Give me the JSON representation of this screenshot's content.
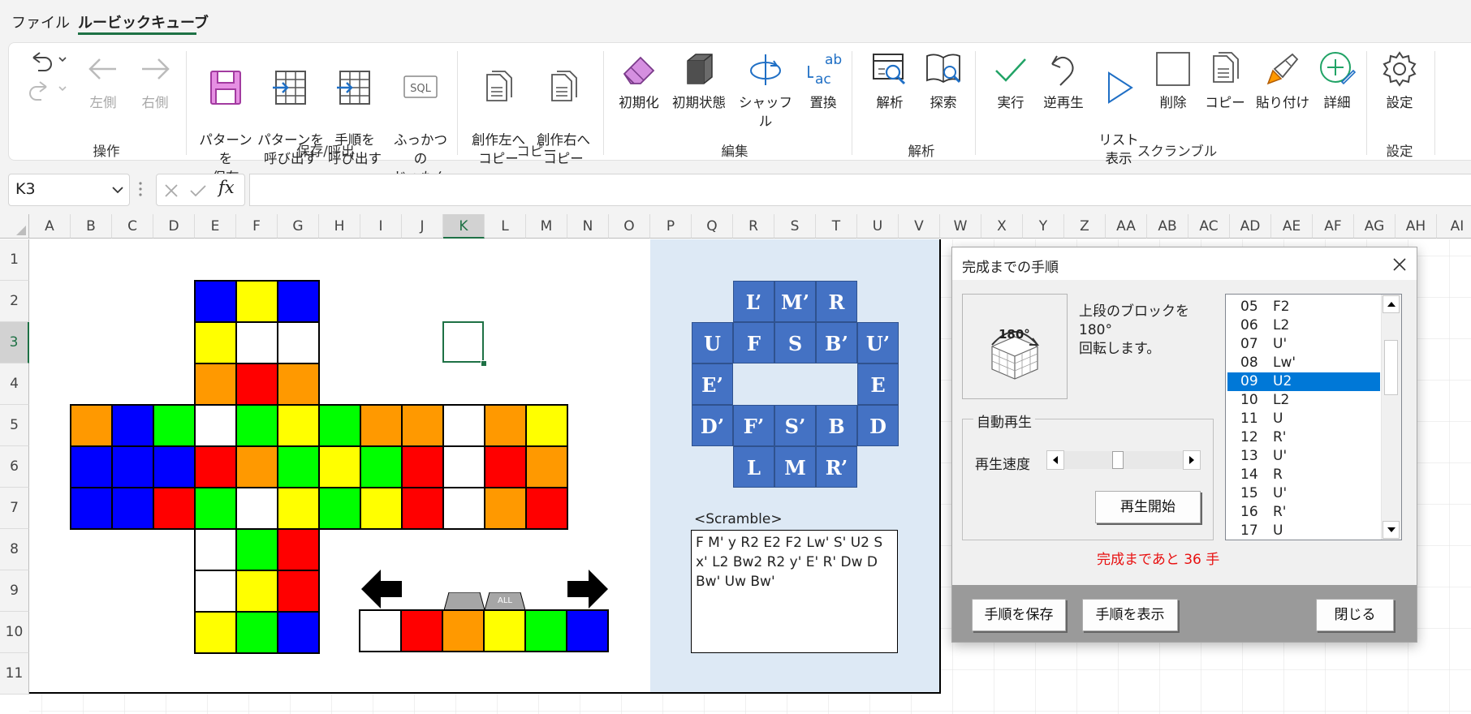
{
  "tabs": [
    "ファイル",
    "ルービックキューブ"
  ],
  "ribbon": {
    "groups": [
      {
        "label": "操作",
        "buttons": [
          "左側",
          "右側"
        ]
      },
      {
        "label": "保存/呼出",
        "buttons": [
          "パターンを\n保存",
          "パターンを\n呼び出す",
          "手順を\n呼び出す",
          "ふっかつの\nじゅもん"
        ]
      },
      {
        "label": "コピー",
        "buttons": [
          "創作左へ\nコピー",
          "創作右へ\nコピー"
        ]
      },
      {
        "label": "編集",
        "buttons": [
          "初期化",
          "初期状態",
          "シャッフル",
          "置換"
        ]
      },
      {
        "label": "解析",
        "buttons": [
          "解析",
          "探索"
        ]
      },
      {
        "label": "スクランブル",
        "buttons": [
          "実行",
          "逆再生",
          "リスト\n表示",
          "削除",
          "コピー",
          "貼り付け",
          "詳細"
        ]
      },
      {
        "label": "設定",
        "buttons": [
          "設定"
        ]
      }
    ]
  },
  "formula_bar": {
    "name_box": "K3",
    "fx": "fx",
    "formula": ""
  },
  "columns": [
    "A",
    "B",
    "C",
    "D",
    "E",
    "F",
    "G",
    "H",
    "I",
    "J",
    "K",
    "L",
    "M",
    "N",
    "O",
    "P",
    "Q",
    "R",
    "S",
    "T",
    "U",
    "V",
    "W",
    "X",
    "Y",
    "Z",
    "AA",
    "AB",
    "AC",
    "AD",
    "AE",
    "AF",
    "AG",
    "AH",
    "AI"
  ],
  "rows": [
    "1",
    "2",
    "3",
    "4",
    "5",
    "6",
    "7",
    "8",
    "9",
    "10",
    "11"
  ],
  "colors": {
    "B": "#0000ff",
    "Y": "#ffff00",
    "W": "#ffffff",
    "O": "#ff9900",
    "R": "#ff0000",
    "G": "#00ff00",
    "accent": "#1e7145",
    "move_blue": "#4472c4",
    "panel_bg": "#dde9f5"
  },
  "cube_net": {
    "up": [
      [
        "B",
        "Y",
        "B"
      ],
      [
        "Y",
        "W",
        "W"
      ],
      [
        "O",
        "R",
        "O"
      ]
    ],
    "middle": [
      [
        "O",
        "B",
        "G",
        "W",
        "G",
        "Y",
        "G",
        "O",
        "O",
        "W",
        "O",
        "Y"
      ],
      [
        "B",
        "B",
        "B",
        "R",
        "O",
        "G",
        "Y",
        "G",
        "R",
        "W",
        "R",
        "O"
      ],
      [
        "B",
        "B",
        "R",
        "G",
        "W",
        "Y",
        "G",
        "Y",
        "R",
        "W",
        "O",
        "R"
      ]
    ],
    "down": [
      [
        "W",
        "G",
        "R"
      ],
      [
        "W",
        "Y",
        "R"
      ],
      [
        "Y",
        "G",
        "B"
      ]
    ]
  },
  "palette": {
    "colors": [
      "W",
      "R",
      "O",
      "Y",
      "G",
      "B"
    ],
    "all_label": "ALL"
  },
  "move_pad": {
    "row1": [
      "L’",
      "M’",
      "R"
    ],
    "row2": [
      "U",
      "F",
      "S",
      "B’",
      "U’"
    ],
    "row3": [
      "E’",
      "E"
    ],
    "row4": [
      "D’",
      "F’",
      "S’",
      "B",
      "D"
    ],
    "row5": [
      "L",
      "M",
      "R’"
    ]
  },
  "scramble": {
    "label": "<Scramble>",
    "text": "F M' y R2 E2 F2 Lw' S' U2 S x' L2 Bw2 R2 y' E' R' Dw D Bw' Uw Bw'"
  },
  "dialog": {
    "title": "完成までの手順",
    "description": "上段のブロックを180°\n回転します。",
    "icon_label": "180°",
    "auto_play_label": "自動再生",
    "speed_label": "再生速度",
    "speed_value": 0.45,
    "play_button": "再生開始",
    "remaining": "完成まであと 36 手",
    "steps": [
      {
        "n": "05",
        "m": "F2"
      },
      {
        "n": "06",
        "m": "L2"
      },
      {
        "n": "07",
        "m": "U'"
      },
      {
        "n": "08",
        "m": "Lw'"
      },
      {
        "n": "09",
        "m": "U2"
      },
      {
        "n": "10",
        "m": "L2"
      },
      {
        "n": "11",
        "m": "U"
      },
      {
        "n": "12",
        "m": "R'"
      },
      {
        "n": "13",
        "m": "U'"
      },
      {
        "n": "14",
        "m": "R"
      },
      {
        "n": "15",
        "m": "U'"
      },
      {
        "n": "16",
        "m": "R'"
      },
      {
        "n": "17",
        "m": "U"
      }
    ],
    "selected_index": 4,
    "buttons": {
      "save": "手順を保存",
      "show": "手順を表示",
      "close": "閉じる"
    }
  }
}
